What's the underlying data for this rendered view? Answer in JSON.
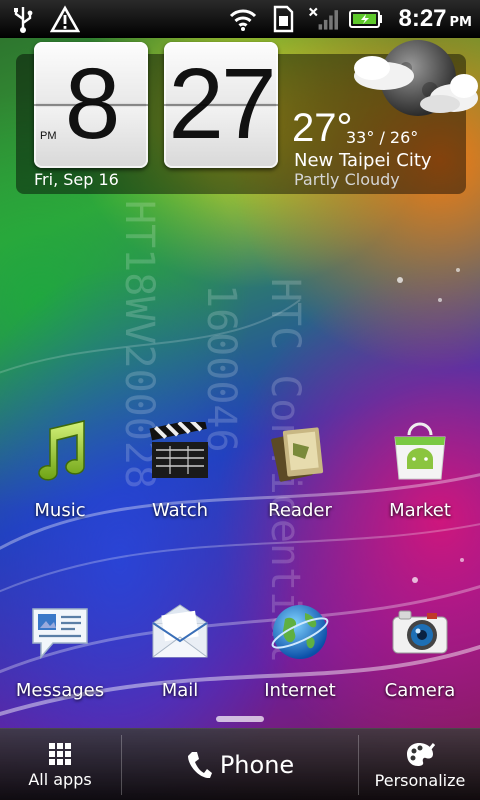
{
  "status_bar": {
    "time": "8:27",
    "ampm": "PM",
    "icons": [
      "usb-icon",
      "warning-icon",
      "wifi-icon",
      "sim-icon",
      "signal-icon",
      "battery-icon"
    ]
  },
  "clock_widget": {
    "hour": "8",
    "minute": "27",
    "ampm": "PM",
    "date": "Fri, Sep 16",
    "temperature": "27°",
    "high_low": "33° / 26°",
    "city": "New Taipei City",
    "condition": "Partly Cloudy",
    "weather_icon": "partly-cloudy-night-icon"
  },
  "watermark": {
    "lines": [
      "HTC Confidential",
      "1600046",
      "HT18WV200028"
    ]
  },
  "apps": [
    {
      "label": "Music",
      "icon": "music-note-icon"
    },
    {
      "label": "Watch",
      "icon": "clapperboard-icon"
    },
    {
      "label": "Reader",
      "icon": "books-icon"
    },
    {
      "label": "Market",
      "icon": "android-market-bag-icon"
    },
    {
      "label": "Messages",
      "icon": "message-bubble-icon"
    },
    {
      "label": "Mail",
      "icon": "envelope-icon"
    },
    {
      "label": "Internet",
      "icon": "globe-icon"
    },
    {
      "label": "Camera",
      "icon": "camera-icon"
    }
  ],
  "dock": {
    "all_apps": "All apps",
    "phone": "Phone",
    "personalize": "Personalize"
  }
}
